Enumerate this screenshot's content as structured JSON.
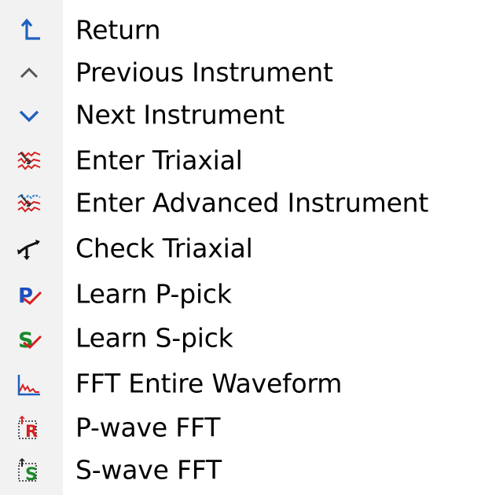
{
  "menu": {
    "items": [
      {
        "label": "Return",
        "icon": "return-arrow-icon"
      },
      {
        "label": "Previous Instrument",
        "icon": "chevron-up-icon"
      },
      {
        "label": "Next Instrument",
        "icon": "chevron-down-icon"
      },
      {
        "label": "Enter Triaxial",
        "icon": "enter-triaxial-icon"
      },
      {
        "label": "Enter Advanced Instrument",
        "icon": "enter-advanced-instrument-icon"
      },
      {
        "label": "Check Triaxial",
        "icon": "check-triaxial-icon"
      },
      {
        "label": "Learn P-pick",
        "icon": "learn-p-pick-icon"
      },
      {
        "label": "Learn S-pick",
        "icon": "learn-s-pick-icon"
      },
      {
        "label": "FFT Entire Waveform",
        "icon": "fft-entire-waveform-icon"
      },
      {
        "label": "P-wave FFT",
        "icon": "p-wave-fft-icon"
      },
      {
        "label": "S-wave FFT",
        "icon": "s-wave-fft-icon"
      }
    ]
  },
  "colors": {
    "blue": "#1f5fbf",
    "gray": "#555555",
    "red": "#d42020",
    "green": "#1a8a2a",
    "gutter": "#f2f2f2"
  }
}
